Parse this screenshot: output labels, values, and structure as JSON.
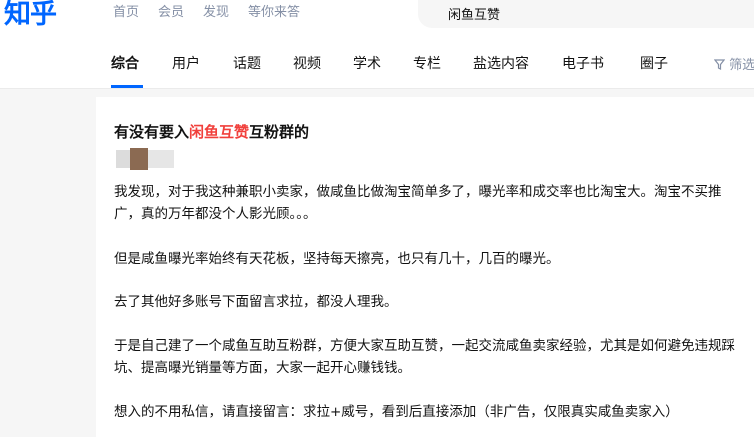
{
  "header": {
    "logo": "知乎",
    "nav": [
      "首页",
      "会员",
      "发现",
      "等你来答"
    ],
    "search_value": "闲鱼互赞"
  },
  "tabs": [
    {
      "label": "综合",
      "active": true
    },
    {
      "label": "用户",
      "active": false
    },
    {
      "label": "话题",
      "active": false
    },
    {
      "label": "视频",
      "active": false
    },
    {
      "label": "学术",
      "active": false
    },
    {
      "label": "专栏",
      "active": false
    },
    {
      "label": "盐选内容",
      "active": false
    },
    {
      "label": "电子书",
      "active": false
    },
    {
      "label": "圈子",
      "active": false
    }
  ],
  "filter_label": "筛选",
  "result": {
    "title_prefix": "有没有要入",
    "title_highlight": "闲鱼互赞",
    "title_suffix": "互粉群的",
    "paragraphs": [
      "我发现，对于我这种兼职小卖家，做咸鱼比做淘宝简单多了，曝光率和成交率也比淘宝大。淘宝不买推广，真的万年都没个人影光顾。。。",
      "但是咸鱼曝光率始终有天花板，坚持每天擦亮，也只有几十，几百的曝光。",
      "去了其他好多账号下面留言求拉，都没人理我。",
      "于是自己建了一个咸鱼互助互粉群，方便大家互助互赞，一起交流咸鱼卖家经验，尤其是如何避免违规踩坑、提高曝光销量等方面，大家一起开心赚钱钱。",
      "想入的不用私信，请直接留言：求拉+威号，看到后直接添加（非广告，仅限真实咸鱼卖家入）"
    ]
  },
  "colors": {
    "brand": "#0066ff",
    "highlight": "#f1403c",
    "muted": "#8590a6"
  }
}
